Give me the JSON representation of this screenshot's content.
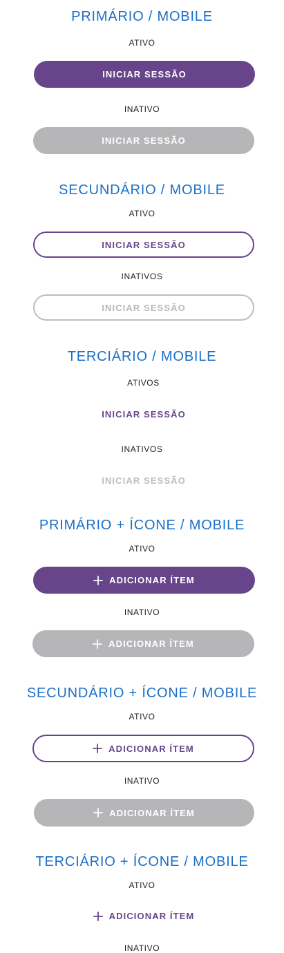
{
  "sections": [
    {
      "title": "PRIMÁRIO / MOBILE",
      "active_label": "ATIVO",
      "active_button": "INICIAR SESSÃO",
      "inactive_label": "INATIVO",
      "inactive_button": "INICIAR SESSÃO"
    },
    {
      "title": "SECUNDÁRIO / MOBILE",
      "active_label": "ATIVO",
      "active_button": "INICIAR SESSÃO",
      "inactive_label": "INATIVOS",
      "inactive_button": "INICIAR SESSÃO"
    },
    {
      "title": "TERCIÁRIO / MOBILE",
      "active_label": "ATIVOS",
      "active_button": "INICIAR SESSÃO",
      "inactive_label": "INATIVOS",
      "inactive_button": "INICIAR SESSÃO"
    },
    {
      "title": "PRIMÁRIO + ÍCONE / MOBILE",
      "active_label": "ATIVO",
      "active_button": "ADICIONAR ÍTEM",
      "inactive_label": "INATIVO",
      "inactive_button": "ADICIONAR ÍTEM"
    },
    {
      "title": "SECUNDÁRIO + ÍCONE / MOBILE",
      "active_label": "ATIVO",
      "active_button": "ADICIONAR ÍTEM",
      "inactive_label": "INATIVO",
      "inactive_button": "ADICIONAR ÍTEM"
    },
    {
      "title": "TERCIÁRIO + ÍCONE / MOBILE",
      "active_label": "ATIVO",
      "active_button": "ADICIONAR ÍTEM",
      "inactive_label": "INATIVO"
    }
  ],
  "icons": {
    "add": "plus-icon"
  },
  "colors": {
    "title": "#1b6fc7",
    "primary": "#68448a",
    "disabled": "#b6b5b8",
    "text": "#222222"
  }
}
